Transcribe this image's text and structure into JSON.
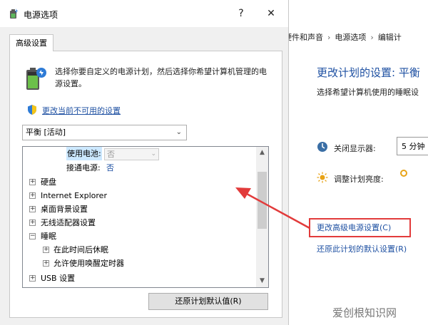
{
  "background_window": {
    "breadcrumb": [
      "硬件和声音",
      "电源选项",
      "编辑计"
    ],
    "title": "更改计划的设置: 平衡",
    "subtitle": "选择希望计算机使用的睡眠设",
    "display_off_label": "关闭显示器:",
    "display_off_value": "5 分钟",
    "brightness_label": "调整计划亮度:",
    "advanced_link": "更改高级电源设置(C)",
    "restore_link": "还原此计划的默认设置(R)",
    "highlight_color": "#e23b3b"
  },
  "dialog": {
    "title": "电源选项",
    "help_button": "?",
    "close_button": "✕",
    "tab_label": "高级设置",
    "description": "选择你要自定义的电源计划，然后选择你希望计算机管理的电源设置。",
    "change_unavailable_link": "更改当前不可用的设置",
    "plan_select_value": "平衡 [活动]",
    "tree": {
      "battery_label": "使用电池:",
      "battery_value": "否",
      "plugged_label": "接通电源:",
      "plugged_value": "否",
      "items": [
        {
          "label": "硬盘",
          "expander": "+"
        },
        {
          "label": "Internet Explorer",
          "expander": "+"
        },
        {
          "label": "桌面背景设置",
          "expander": "+"
        },
        {
          "label": "无线适配器设置",
          "expander": "+"
        },
        {
          "label": "睡眠",
          "expander": "−"
        }
      ],
      "sleep_children": [
        {
          "label": "在此时间后休眠",
          "expander": "+"
        },
        {
          "label": "允许使用唤醒定时器",
          "expander": "+"
        }
      ],
      "last_item": {
        "label": "USB 设置",
        "expander": "+"
      }
    },
    "restore_button": "还原计划默认值(R)"
  },
  "watermark": "爱创根知识网",
  "colors": {
    "link": "#1e50a2",
    "arrow": "#e23b3b",
    "selection": "#cce8ff"
  }
}
